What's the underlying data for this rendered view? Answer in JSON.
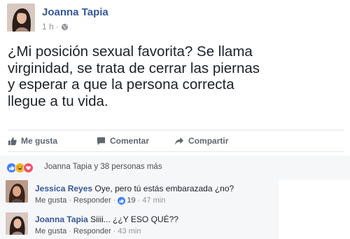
{
  "post": {
    "author": "Joanna Tapia",
    "time": "1 h",
    "privacy_icon": "globe-icon",
    "text_lines": [
      "¿Mi posición sexual favorita? Se llama",
      "virginidad, se trata de cerrar las piernas",
      "y esperar a que la persona correcta",
      "llegue a tu vida."
    ]
  },
  "actions": {
    "like_label": "Me gusta",
    "comment_label": "Comentar",
    "share_label": "Compartir"
  },
  "reactions": {
    "icons": [
      "like-reaction-icon",
      "haha-reaction-icon",
      "love-reaction-icon"
    ],
    "summary": "Joanna Tapia y 38 personas más"
  },
  "comments": [
    {
      "author": "Jessica Reyes",
      "text": "Oye, pero tú estás embarazada ¿no?",
      "like_label": "Me gusta",
      "reply_label": "Responder",
      "like_count": "19",
      "time": "47 min"
    },
    {
      "author": "Joanna Tapia",
      "text": "Siiii... ¿¿Y ESO QUÉ??",
      "like_label": "Me gusta",
      "reply_label": "Responder",
      "time": "43 min"
    }
  ],
  "colors": {
    "link_blue": "#365899",
    "like_blue": "#4080ff",
    "haha_yellow": "#f7b125",
    "love_red": "#f25268",
    "feedback_bg": "#f6f7f9"
  }
}
